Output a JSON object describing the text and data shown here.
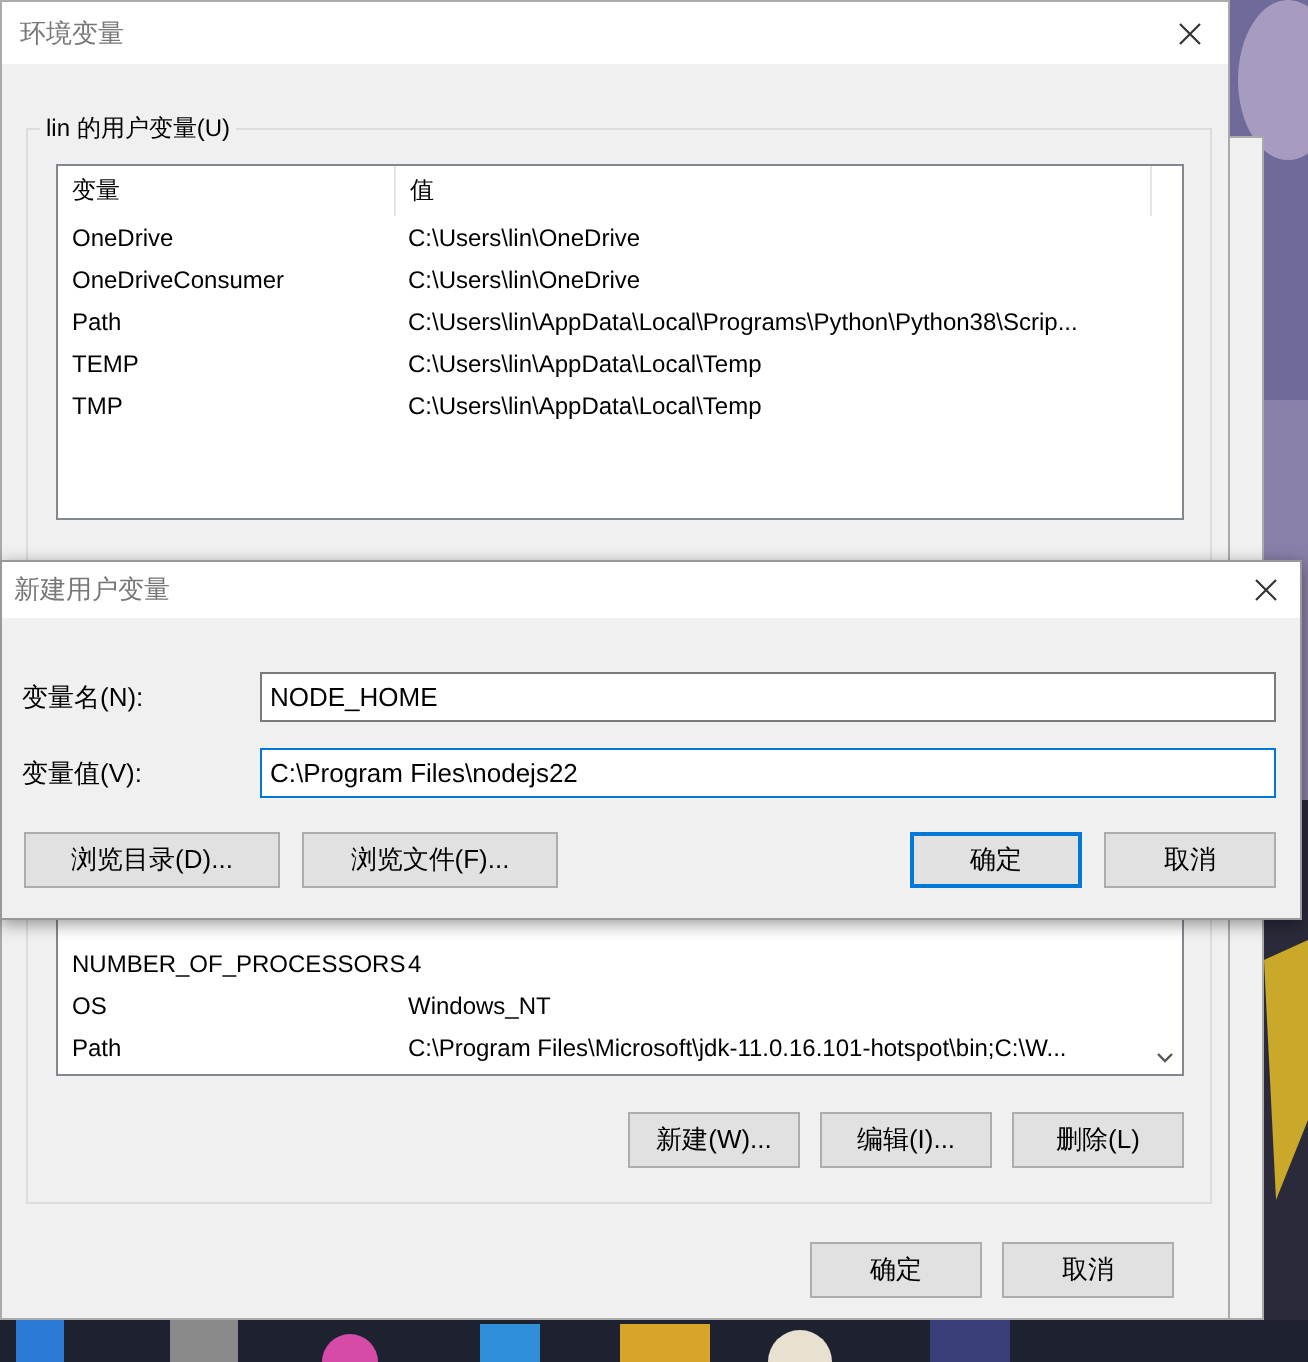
{
  "main_window": {
    "title": "环境变量",
    "user_variables": {
      "legend": "lin 的用户变量(U)",
      "columns": [
        "变量",
        "值"
      ],
      "rows": [
        {
          "name": "OneDrive",
          "value": "C:\\Users\\lin\\OneDrive"
        },
        {
          "name": "OneDriveConsumer",
          "value": "C:\\Users\\lin\\OneDrive"
        },
        {
          "name": "Path",
          "value": "C:\\Users\\lin\\AppData\\Local\\Programs\\Python\\Python38\\Scrip..."
        },
        {
          "name": "TEMP",
          "value": "C:\\Users\\lin\\AppData\\Local\\Temp"
        },
        {
          "name": "TMP",
          "value": "C:\\Users\\lin\\AppData\\Local\\Temp"
        }
      ]
    },
    "system_variables": {
      "rows": [
        {
          "name": "NUMBER_OF_PROCESSORS",
          "value": "4"
        },
        {
          "name": "OS",
          "value": "Windows_NT"
        },
        {
          "name": "Path",
          "value": "C:\\Program Files\\Microsoft\\jdk-11.0.16.101-hotspot\\bin;C:\\W..."
        }
      ],
      "buttons": [
        "新建(W)...",
        "编辑(I)...",
        "删除(L)"
      ]
    },
    "buttons": [
      "确定",
      "取消"
    ]
  },
  "dialog": {
    "title": "新建用户变量",
    "fields": [
      {
        "label": "变量名(N):",
        "value": "NODE_HOME",
        "focused": false
      },
      {
        "label": "变量值(V):",
        "value": "C:\\Program Files\\nodejs22",
        "focused": true
      }
    ],
    "buttons": [
      {
        "label": "浏览目录(D)...",
        "default": false
      },
      {
        "label": "浏览文件(F)...",
        "default": false
      },
      {
        "label": "确定",
        "default": true
      },
      {
        "label": "取消",
        "default": false
      }
    ]
  }
}
